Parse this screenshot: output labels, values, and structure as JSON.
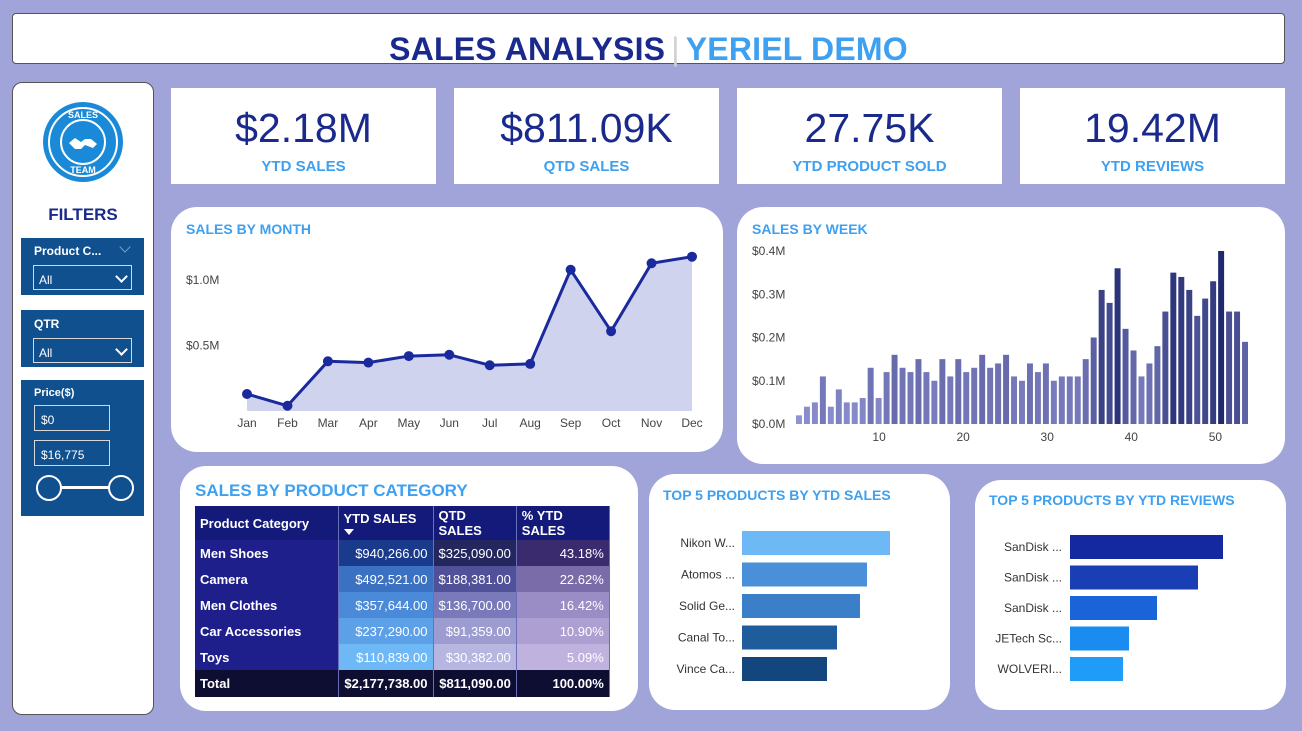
{
  "header": {
    "title": "SALES ANALYSIS",
    "separator": "|",
    "subtitle": "YERIEL DEMO"
  },
  "sidebar": {
    "logo_text_top": "SALES",
    "logo_text_bottom": "TEAM",
    "filters_title": "FILTERS",
    "product_category": {
      "label": "Product C...",
      "value": "All"
    },
    "qtr": {
      "label": "QTR",
      "value": "All"
    },
    "price": {
      "label": "Price($)",
      "min": "$0",
      "max": "$16,775"
    }
  },
  "kpis": [
    {
      "value": "$2.18M",
      "label": "YTD SALES"
    },
    {
      "value": "$811.09K",
      "label": "QTD SALES"
    },
    {
      "value": "27.75K",
      "label": "YTD PRODUCT SOLD"
    },
    {
      "value": "19.42M",
      "label": "YTD REVIEWS"
    }
  ],
  "chart_data": [
    {
      "type": "area",
      "title": "SALES BY MONTH",
      "categories": [
        "Jan",
        "Feb",
        "Mar",
        "Apr",
        "May",
        "Jun",
        "Jul",
        "Aug",
        "Sep",
        "Oct",
        "Nov",
        "Dec"
      ],
      "values": [
        0.13,
        0.04,
        0.38,
        0.37,
        0.42,
        0.43,
        0.35,
        0.36,
        1.08,
        0.61,
        1.13,
        1.18
      ],
      "y_ticks": [
        "$1.0M",
        "$0.5M"
      ],
      "y_tick_values": [
        1.0,
        0.5
      ],
      "ylim": [
        0,
        1.3
      ],
      "color": "#1a2a9c",
      "fill": "#d0d3ee"
    },
    {
      "type": "bar",
      "title": "SALES BY WEEK",
      "x": [
        1,
        2,
        3,
        4,
        5,
        6,
        7,
        8,
        9,
        10,
        11,
        12,
        13,
        14,
        15,
        16,
        17,
        18,
        19,
        20,
        21,
        22,
        23,
        24,
        25,
        26,
        27,
        28,
        29,
        30,
        31,
        32,
        33,
        34,
        35,
        36,
        37,
        38,
        39,
        40,
        41,
        42,
        43,
        44,
        45,
        46,
        47,
        48,
        49,
        50,
        51,
        52,
        53
      ],
      "values": [
        0.02,
        0.04,
        0.05,
        0.11,
        0.04,
        0.08,
        0.05,
        0.05,
        0.06,
        0.13,
        0.06,
        0.12,
        0.16,
        0.13,
        0.12,
        0.15,
        0.12,
        0.1,
        0.15,
        0.11,
        0.15,
        0.12,
        0.13,
        0.16,
        0.13,
        0.14,
        0.16,
        0.11,
        0.1,
        0.14,
        0.12,
        0.14,
        0.1,
        0.11,
        0.11,
        0.11,
        0.15,
        0.2,
        0.31,
        0.28,
        0.36,
        0.22,
        0.17,
        0.11,
        0.14,
        0.18,
        0.26,
        0.35,
        0.34,
        0.31,
        0.25,
        0.29,
        0.33,
        0.4,
        0.26,
        0.26,
        0.19
      ],
      "x_ticks": [
        "10",
        "20",
        "30",
        "40",
        "50"
      ],
      "x_tick_values": [
        10,
        20,
        30,
        40,
        50
      ],
      "y_ticks": [
        "$0.4M",
        "$0.3M",
        "$0.2M",
        "$0.1M",
        "$0.0M"
      ],
      "y_tick_values": [
        0.4,
        0.3,
        0.2,
        0.1,
        0.0
      ],
      "ylim": [
        0,
        0.4
      ],
      "xlim": [
        0,
        54
      ]
    },
    {
      "type": "table",
      "title": "SALES BY PRODUCT CATEGORY",
      "columns": [
        "Product Category",
        "YTD SALES",
        "QTD SALES",
        "% YTD SALES"
      ],
      "rows": [
        [
          "Men Shoes",
          "$940,266.00",
          "$325,090.00",
          "43.18%"
        ],
        [
          "Camera",
          "$492,521.00",
          "$188,381.00",
          "22.62%"
        ],
        [
          "Men Clothes",
          "$357,644.00",
          "$136,700.00",
          "16.42%"
        ],
        [
          "Car Accessories",
          "$237,290.00",
          "$91,359.00",
          "10.90%"
        ],
        [
          "Toys",
          "$110,839.00",
          "$30,382.00",
          "5.09%"
        ]
      ],
      "total": [
        "Total",
        "$2,177,738.00",
        "$811,090.00",
        "100.00%"
      ],
      "cell_colors": [
        [
          "#1e1f8a",
          "#1a3a8c",
          "#24265e",
          "#3a2a6e"
        ],
        [
          "#1e1f8a",
          "#3b71c2",
          "#51519a",
          "#7a6ca8"
        ],
        [
          "#1e1f8a",
          "#4a8ad8",
          "#7a7aba",
          "#9a8cc4"
        ],
        [
          "#1e1f8a",
          "#5ca0e8",
          "#9c9cd0",
          "#ad9fd2"
        ],
        [
          "#1e1f8a",
          "#6fb8f6",
          "#b6b6e0",
          "#c0b2de"
        ]
      ]
    },
    {
      "type": "bar",
      "title": "TOP 5 PRODUCTS BY YTD SALES",
      "categories": [
        "Nikon W...",
        "Atomos ...",
        "Solid Ge...",
        "Canal To...",
        "Vince Ca..."
      ],
      "values": [
        148,
        125,
        118,
        95,
        85
      ],
      "colors": [
        "#6fb8f6",
        "#4a90d8",
        "#3a7fc8",
        "#1e5c9c",
        "#14467e"
      ]
    },
    {
      "type": "bar",
      "title": "TOP 5 PRODUCTS BY YTD REVIEWS",
      "categories": [
        "SanDisk ...",
        "SanDisk ...",
        "SanDisk ...",
        "JETech Sc...",
        "WOLVERI..."
      ],
      "values": [
        153,
        128,
        87,
        59,
        53
      ],
      "colors": [
        "#1428a0",
        "#1a3eb4",
        "#1a64d8",
        "#1a8cf0",
        "#1e9cf8"
      ]
    }
  ]
}
